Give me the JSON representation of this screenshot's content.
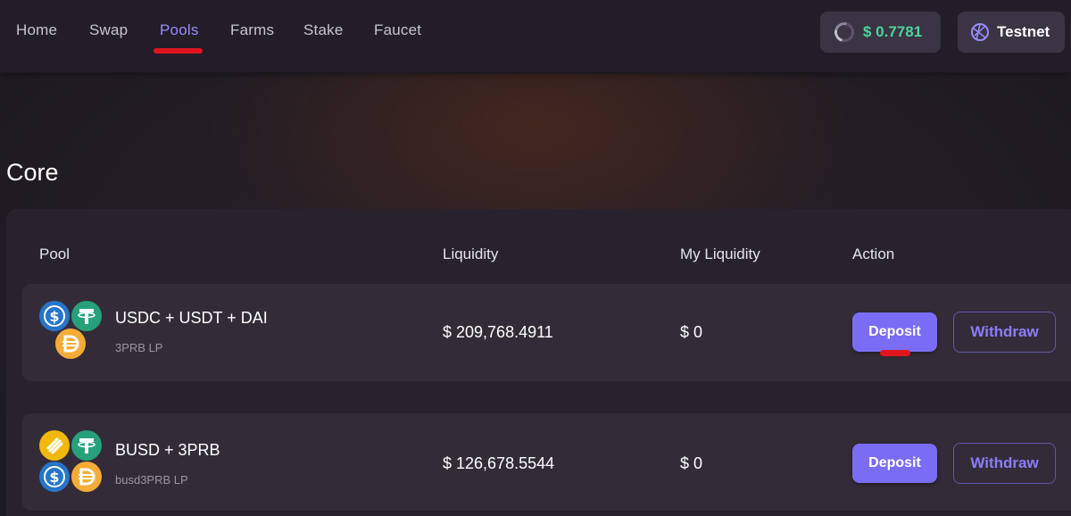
{
  "nav": {
    "items": [
      {
        "label": "Home"
      },
      {
        "label": "Swap"
      },
      {
        "label": "Pools",
        "active": true
      },
      {
        "label": "Farms"
      },
      {
        "label": "Stake"
      },
      {
        "label": "Faucet"
      }
    ],
    "price": "$ 0.7781",
    "network": "Testnet"
  },
  "section": {
    "title": "Core"
  },
  "table": {
    "headers": {
      "pool": "Pool",
      "liquidity": "Liquidity",
      "my_liquidity": "My Liquidity",
      "action": "Action"
    },
    "rows": [
      {
        "name": "USDC + USDT + DAI",
        "lp": "3PRB LP",
        "liquidity": "$ 209,768.4911",
        "my_liquidity": "$ 0",
        "deposit_label": "Deposit",
        "withdraw_label": "Withdraw",
        "tokens": [
          "usdc-icon",
          "usdt-icon",
          "dai-icon"
        ]
      },
      {
        "name": "BUSD + 3PRB",
        "lp": "busd3PRB LP",
        "liquidity": "$ 126,678.5544",
        "my_liquidity": "$ 0",
        "deposit_label": "Deposit",
        "withdraw_label": "Withdraw",
        "tokens": [
          "busd-icon",
          "usdt-icon",
          "usdc-icon",
          "dai-icon"
        ]
      }
    ]
  },
  "colors": {
    "accent": "#7a6cf5",
    "nav_active": "#9b8cff",
    "price_green": "#4fd39a",
    "annotation_red": "#e0161e"
  }
}
